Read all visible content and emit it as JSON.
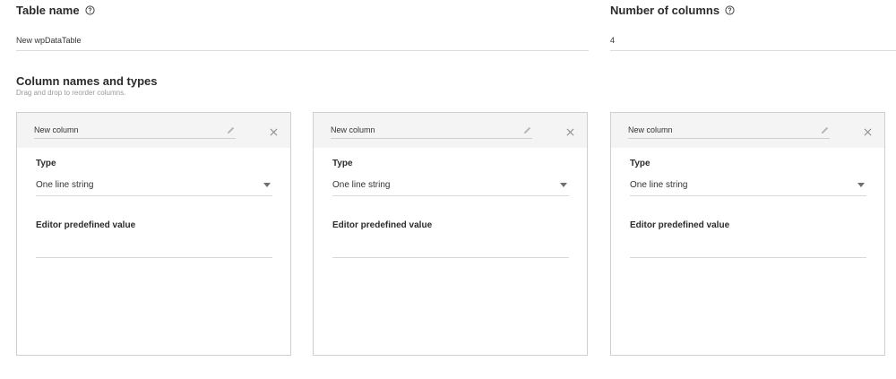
{
  "table_name": {
    "label": "Table name",
    "value": "New wpDataTable"
  },
  "num_columns": {
    "label": "Number of columns",
    "value": "4"
  },
  "columns_section": {
    "title": "Column names and types",
    "subtitle": "Drag and drop to reorder columns."
  },
  "columns": [
    {
      "name": "New column",
      "type_label": "Type",
      "type_value": "One line string",
      "editor_label": "Editor predefined value",
      "editor_value": ""
    },
    {
      "name": "New column",
      "type_label": "Type",
      "type_value": "One line string",
      "editor_label": "Editor predefined value",
      "editor_value": ""
    },
    {
      "name": "New column",
      "type_label": "Type",
      "type_value": "One line string",
      "editor_label": "Editor predefined value",
      "editor_value": ""
    }
  ],
  "icons": {
    "help": "help-circle-icon",
    "edit": "pencil-icon",
    "remove": "close-icon",
    "dropdown": "caret-down-icon"
  }
}
